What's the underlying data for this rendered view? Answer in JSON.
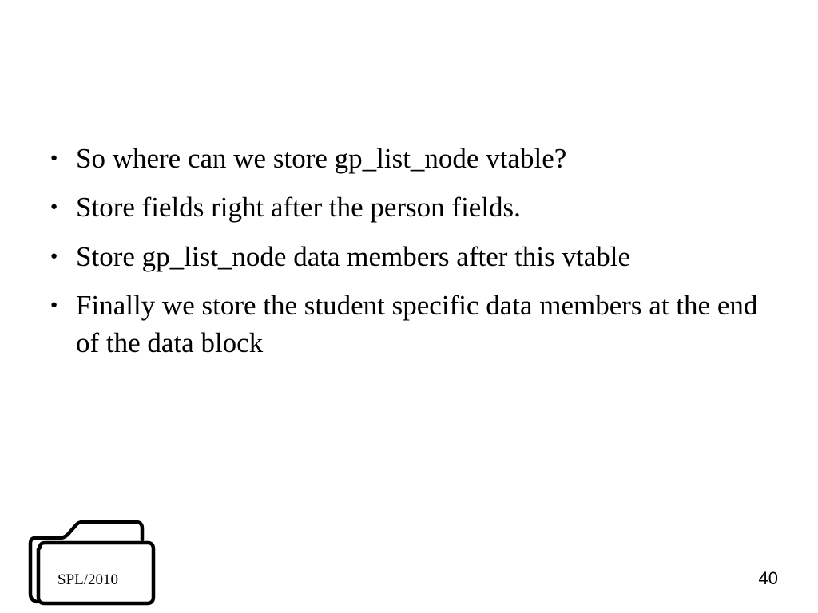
{
  "bullets": [
    "So where can we store gp_list_node vtable?",
    "Store fields right after the person fields.",
    "Store gp_list_node data members after this vtable",
    "Finally we store the student specific data members at the end of the data block"
  ],
  "footer": {
    "folder_label": "SPL/2010",
    "page_number": "40"
  }
}
